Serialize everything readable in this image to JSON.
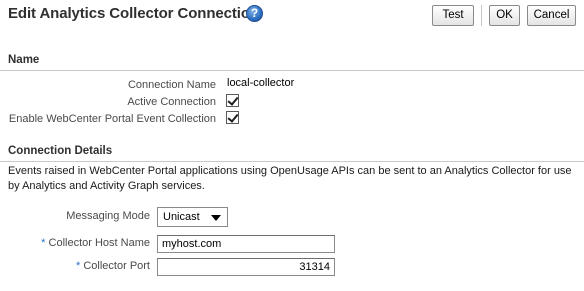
{
  "header": {
    "title": "Edit Analytics Collector Connection",
    "help_icon": "help-icon",
    "help_symbol": "?"
  },
  "toolbar": {
    "test_label": "Test",
    "ok_label": "OK",
    "cancel_label": "Cancel"
  },
  "name_section": {
    "heading": "Name",
    "connection_name_label": "Connection Name",
    "connection_name_value": "local-collector",
    "active_connection_label": "Active Connection",
    "active_connection_checked": true,
    "enable_event_label": "Enable WebCenter Portal Event Collection",
    "enable_event_checked": true
  },
  "details_section": {
    "heading": "Connection Details",
    "description": "Events raised in WebCenter Portal applications using OpenUsage APIs can be sent to an Analytics Collector for use by Analytics and Activity Graph services.",
    "messaging_mode_label": "Messaging Mode",
    "messaging_mode_value": "Unicast",
    "required_marker": "*",
    "host_label": "Collector Host Name",
    "host_value": "myhost.com",
    "port_label": "Collector Port",
    "port_value": "31314"
  },
  "colors": {
    "required": "#2a6fc9",
    "help_icon": "#2c6fc2"
  }
}
